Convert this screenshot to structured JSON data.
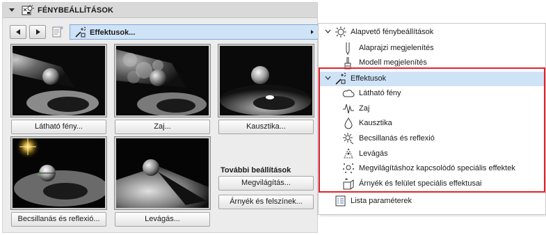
{
  "panel": {
    "title": "FÉNYBEÁLLÍTÁSOK",
    "dropdown_value": "Effektusok...",
    "more_settings_title": "További beállítások",
    "effects": [
      {
        "label": "Látható fény..."
      },
      {
        "label": "Zaj..."
      },
      {
        "label": "Kausztika..."
      },
      {
        "label": "Becsillanás és reflexió..."
      },
      {
        "label": "Levágás..."
      }
    ],
    "extra_buttons": [
      {
        "label": "Megvilágítás..."
      },
      {
        "label": "Árnyék és felszínek..."
      }
    ]
  },
  "tree": {
    "items": [
      {
        "label": "Alapvető fénybeállítások",
        "icon": "sun-gear-icon",
        "expanded": true
      },
      {
        "label": "Alaprajzi megjelenítés",
        "icon": "pencil-icon"
      },
      {
        "label": "Modell megjelenítés",
        "icon": "brush-icon"
      },
      {
        "label": "Effektusok",
        "icon": "magic-wand-icon",
        "expanded": true,
        "selected": true
      },
      {
        "label": "Látható fény",
        "icon": "cloud-icon"
      },
      {
        "label": "Zaj",
        "icon": "noise-wave-icon"
      },
      {
        "label": "Kausztika",
        "icon": "drop-icon"
      },
      {
        "label": "Becsillanás és reflexió",
        "icon": "sparkle-icon"
      },
      {
        "label": "Levágás",
        "icon": "clip-cone-icon"
      },
      {
        "label": "Megvilágításhoz kapcsolódó speciális effektek",
        "icon": "light-dots-icon"
      },
      {
        "label": "Árnyék és felület speciális effektusai",
        "icon": "shadow-box-icon"
      },
      {
        "label": "Lista paraméterek",
        "icon": "list-icon"
      }
    ]
  },
  "colors": {
    "selection": "#cfe3f7",
    "highlight_border": "#e8202a",
    "panel_bg": "#ececec"
  }
}
